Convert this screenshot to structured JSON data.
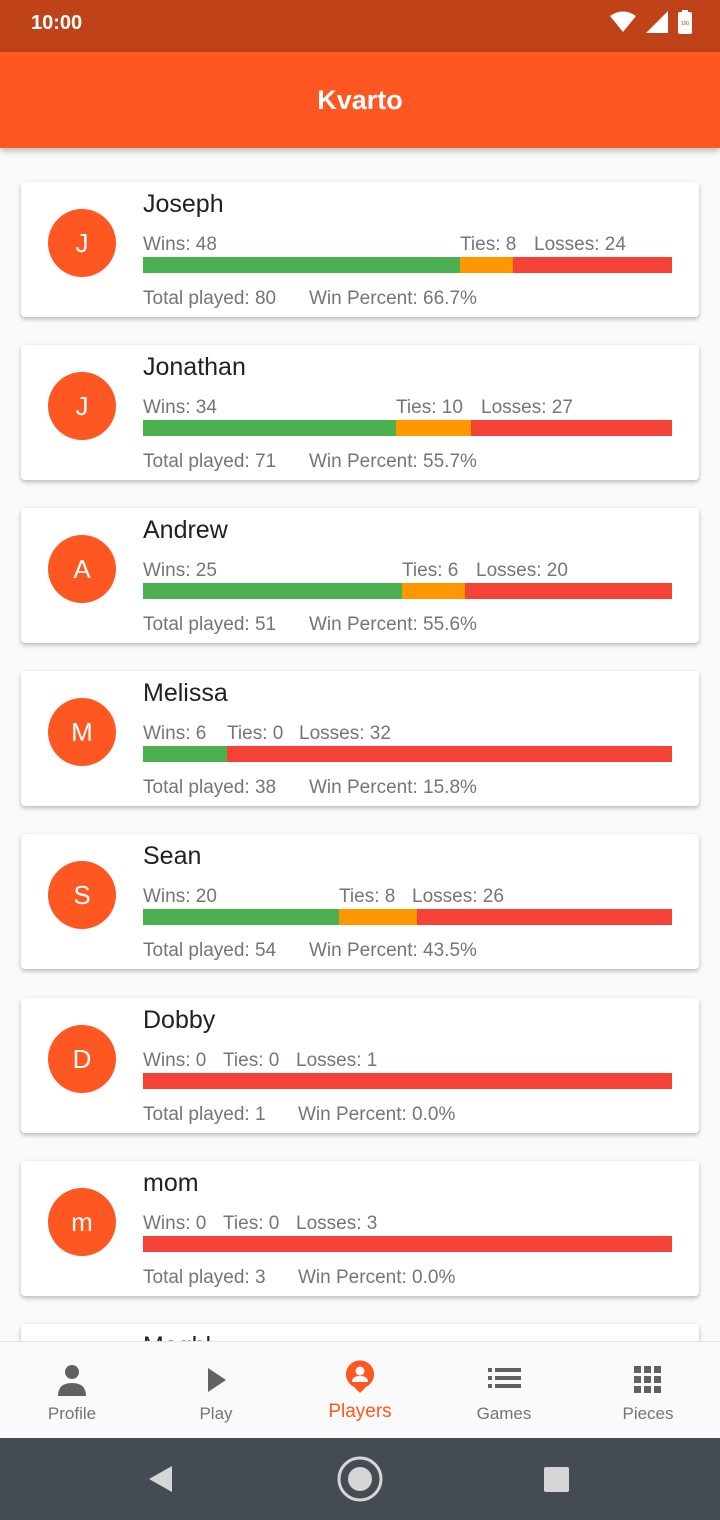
{
  "status_bar": {
    "time": "10:00",
    "battery": "100"
  },
  "app_bar": {
    "title": "Kvarto"
  },
  "labels": {
    "wins": "Wins: ",
    "ties": "Ties: ",
    "losses": "Losses: ",
    "total": "Total played: ",
    "pct": "Win Percent: "
  },
  "players": [
    {
      "initial": "J",
      "name": "Joseph",
      "wins": "Wins: 48",
      "ties": "Ties: 8",
      "losses": "Losses: 24",
      "total": "Total played: 80",
      "pct": "Win Percent: 66.7%",
      "w": 48,
      "t": 8,
      "l": 24
    },
    {
      "initial": "J",
      "name": "Jonathan",
      "wins": "Wins: 34",
      "ties": "Ties: 10",
      "losses": "Losses: 27",
      "total": "Total played: 71",
      "pct": "Win Percent: 55.7%",
      "w": 34,
      "t": 10,
      "l": 27
    },
    {
      "initial": "A",
      "name": "Andrew",
      "wins": "Wins: 25",
      "ties": "Ties: 6",
      "losses": "Losses: 20",
      "total": "Total played: 51",
      "pct": "Win Percent: 55.6%",
      "w": 25,
      "t": 6,
      "l": 20
    },
    {
      "initial": "M",
      "name": "Melissa",
      "wins": "Wins: 6",
      "ties": "Ties: 0",
      "losses": "Losses: 32",
      "total": "Total played: 38",
      "pct": "Win Percent: 15.8%",
      "w": 6,
      "t": 0,
      "l": 32
    },
    {
      "initial": "S",
      "name": "Sean",
      "wins": "Wins: 20",
      "ties": "Ties: 8",
      "losses": "Losses: 26",
      "total": "Total played: 54",
      "pct": "Win Percent: 43.5%",
      "w": 20,
      "t": 8,
      "l": 26
    },
    {
      "initial": "D",
      "name": "Dobby",
      "wins": "Wins: 0",
      "ties": "Ties: 0",
      "losses": "Losses: 1",
      "total": "Total played: 1",
      "pct": "Win Percent: 0.0%",
      "w": 0,
      "t": 0,
      "l": 1
    },
    {
      "initial": "m",
      "name": "mom",
      "wins": "Wins: 0",
      "ties": "Ties: 0",
      "losses": "Losses: 3",
      "total": "Total played: 3",
      "pct": "Win Percent: 0.0%",
      "w": 0,
      "t": 0,
      "l": 3
    },
    {
      "initial": "",
      "name": "Meghl",
      "wins": "",
      "ties": "",
      "losses": "",
      "total": "",
      "pct": "",
      "w": 0,
      "t": 0,
      "l": 0
    }
  ],
  "bottom_nav": [
    {
      "label": "Profile",
      "icon": "person-icon",
      "active": false
    },
    {
      "label": "Play",
      "icon": "play-icon",
      "active": false
    },
    {
      "label": "Players",
      "icon": "players-icon",
      "active": true
    },
    {
      "label": "Games",
      "icon": "list-icon",
      "active": false
    },
    {
      "label": "Pieces",
      "icon": "grid-icon",
      "active": false
    }
  ],
  "colors": {
    "primary": "#ff5722",
    "status_bar": "#bf4218",
    "wins": "#4caf50",
    "ties": "#ff9800",
    "losses": "#f44336"
  }
}
